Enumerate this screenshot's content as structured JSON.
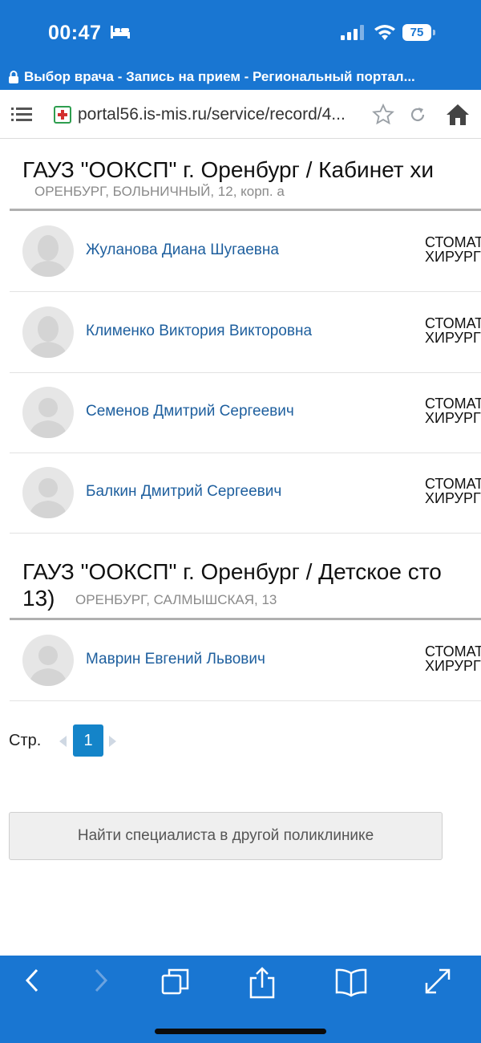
{
  "status_bar": {
    "time": "00:47",
    "battery": "75"
  },
  "browser": {
    "page_title": "Выбор врача - Запись на прием - Региональный портал...",
    "url": "portal56.is-mis.ru/service/record/4..."
  },
  "groups": [
    {
      "title": "ГАУЗ \"ООКСП\" г. Оренбург / Кабинет хи",
      "address": "ОРЕНБУРГ, БОЛЬНИЧНЫЙ, 12, корп. а",
      "doctors": [
        {
          "name": "Жуланова Диана Шугаевна",
          "spec_line1": "СТОМАТ",
          "spec_line2": "ХИРУРГ",
          "avatar": "female-avatar-icon"
        },
        {
          "name": "Клименко Виктория Викторовна",
          "spec_line1": "СТОМАТ",
          "spec_line2": "ХИРУРГ",
          "avatar": "female-avatar-icon"
        },
        {
          "name": "Семенов Дмитрий Сергеевич",
          "spec_line1": "СТОМАТ",
          "spec_line2": "ХИРУРГ",
          "avatar": "male-avatar-icon"
        },
        {
          "name": "Балкин Дмитрий Сергеевич",
          "spec_line1": "СТОМАТ",
          "spec_line2": "ХИРУРГ",
          "avatar": "male-avatar-icon"
        }
      ]
    },
    {
      "title_line1": "ГАУЗ \"ООКСП\" г. Оренбург / Детское сто",
      "title_line2": "13)",
      "address": "ОРЕНБУРГ, САЛМЫШСКАЯ, 13",
      "doctors": [
        {
          "name": "Маврин Евгений Львович",
          "spec_line1": "СТОМАТ",
          "spec_line2": "ХИРУРГ",
          "avatar": "male-avatar-icon"
        }
      ]
    }
  ],
  "pagination": {
    "label": "Стр.",
    "current": "1"
  },
  "find_button": "Найти специалиста в другой поликлинике",
  "colors": {
    "bar": "#1976d2",
    "link": "#1e5f9e",
    "active_page": "#1484c9"
  }
}
